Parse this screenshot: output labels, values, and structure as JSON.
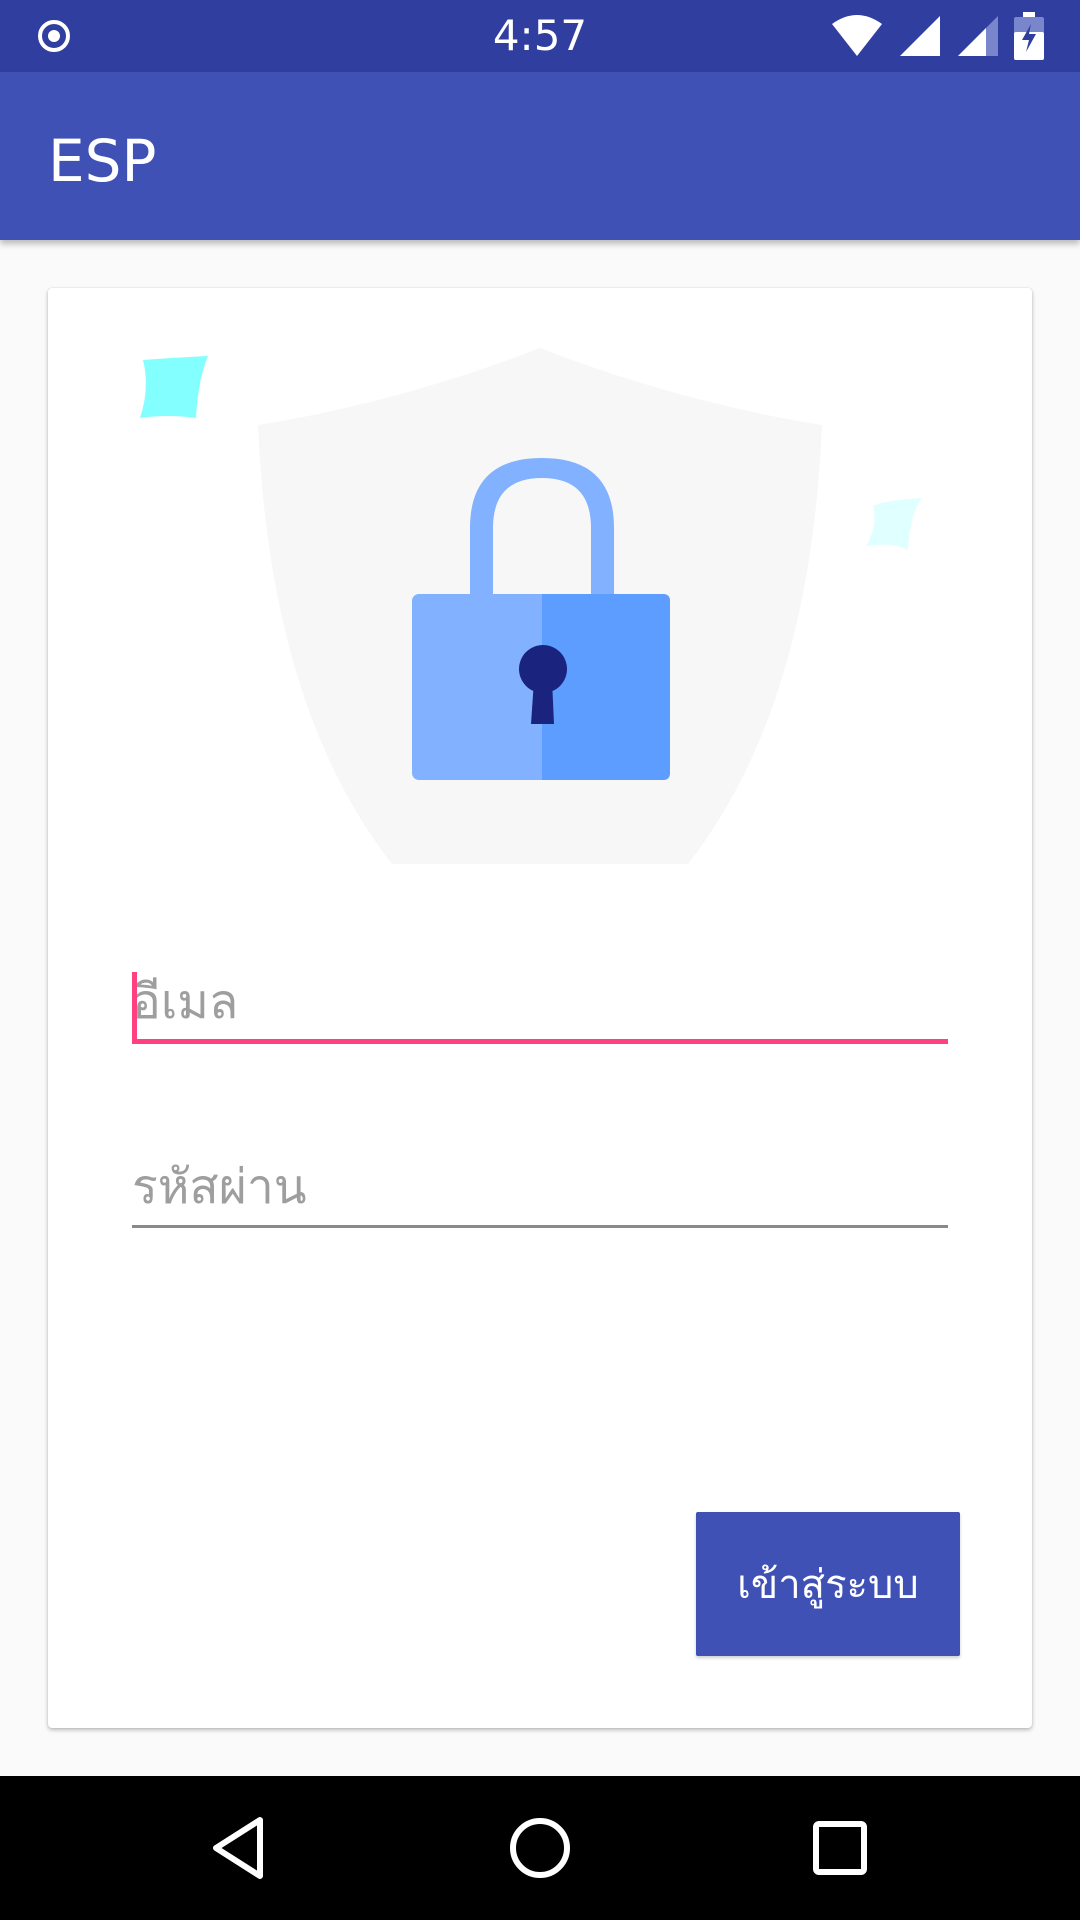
{
  "status_bar": {
    "time": "4:57",
    "icons": [
      "circle-dot-icon",
      "wifi-icon",
      "signal-icon",
      "signal-weak-icon",
      "battery-charging-icon"
    ]
  },
  "app_bar": {
    "title": "ESP"
  },
  "login_form": {
    "illustration": "shield-lock-icon",
    "email": {
      "placeholder": "อีเมล",
      "value": ""
    },
    "password": {
      "placeholder": "รหัสผ่าน",
      "value": ""
    },
    "submit_label": "เข้าสู่ระบบ"
  },
  "nav_bar": {
    "icons": [
      "back-icon",
      "home-icon",
      "recents-icon"
    ]
  },
  "colors": {
    "status_bar": "#303f9f",
    "primary": "#3f51b5",
    "accent": "#ff4081",
    "lock_light": "#82b1ff",
    "lock_dark": "#5c9dff",
    "keyhole": "#1a237e",
    "sparkle": "#84ffff"
  }
}
